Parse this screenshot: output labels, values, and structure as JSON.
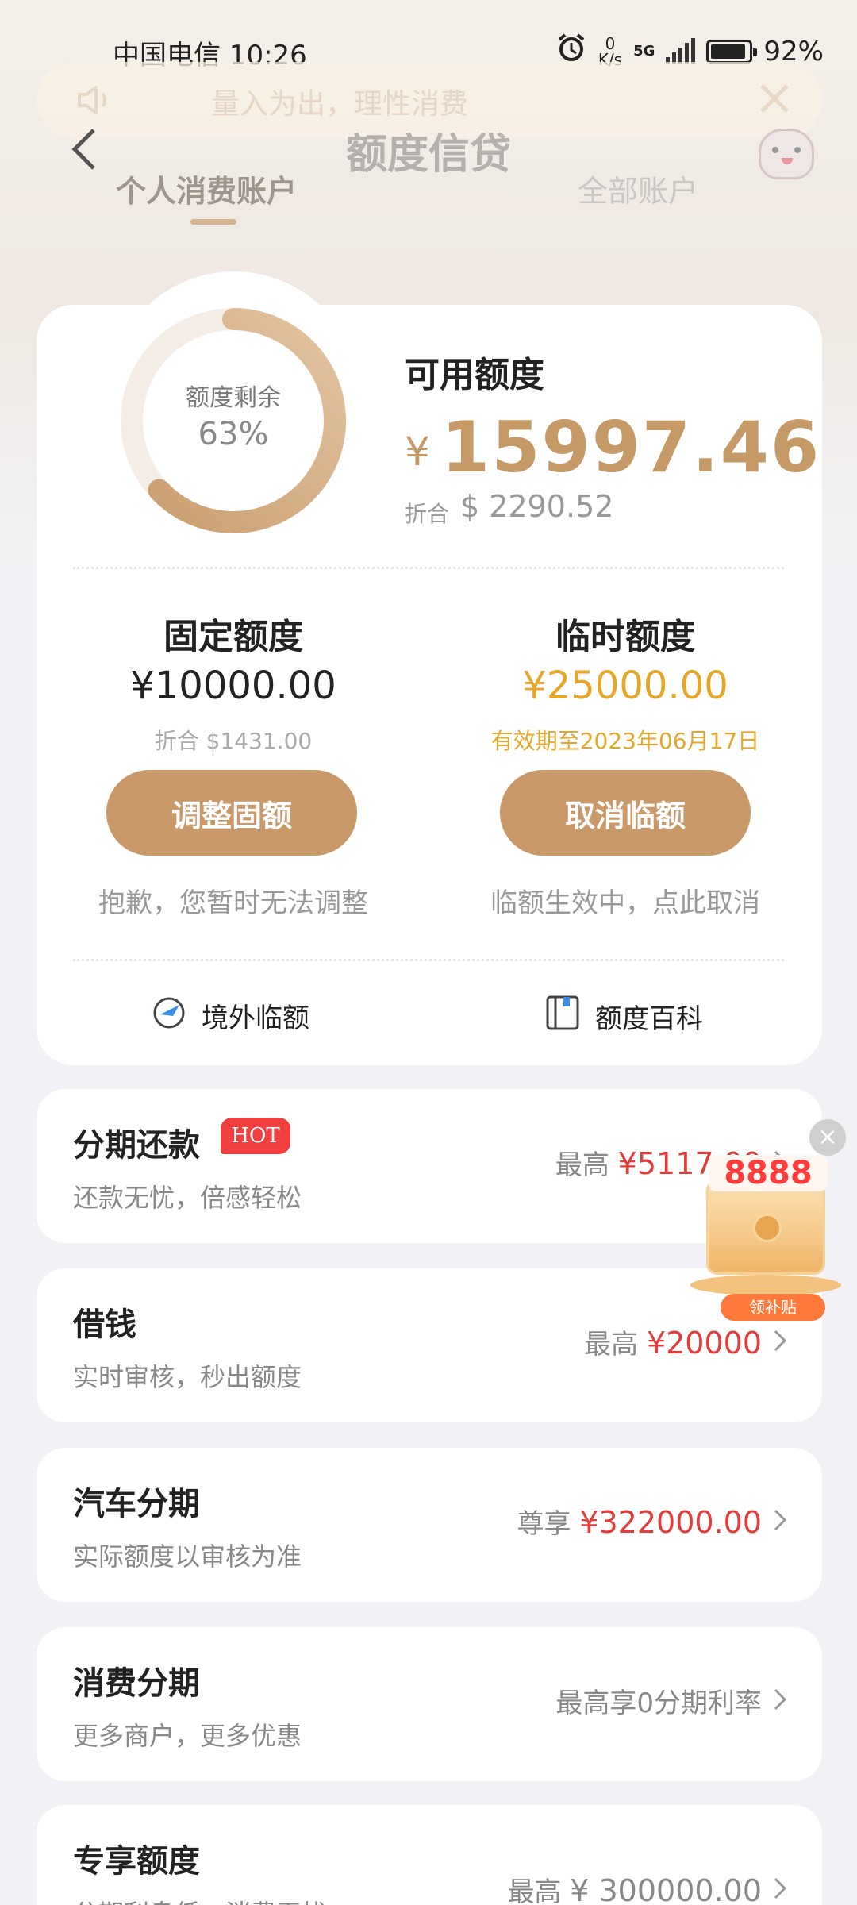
{
  "status_bar": {
    "carrier_time": "中国电信 10:26",
    "net_speed_value": "0",
    "net_speed_unit": "K/s",
    "network": "5G",
    "battery": "92%"
  },
  "notice": {
    "text": "量入为出，理性消费"
  },
  "header": {
    "title": "额度信贷"
  },
  "tabs": [
    {
      "label": "个人消费账户",
      "active": true
    },
    {
      "label": "全部账户",
      "active": false
    }
  ],
  "credit": {
    "remaining_label": "额度剩余",
    "remaining_percent_text": "63%",
    "remaining_fraction": 0.63,
    "available_label": "可用额度",
    "currency_symbol": "¥",
    "available_amount": "15997.46",
    "fx_label": "折合",
    "fx_value": "$ 2290.52"
  },
  "fixed": {
    "title": "固定额度",
    "amount": "¥10000.00",
    "sub": "折合 $1431.00",
    "button": "调整固额",
    "note": "抱歉，您暂时无法调整"
  },
  "temp": {
    "title": "临时额度",
    "amount": "¥25000.00",
    "sub": "有效期至2023年06月17日",
    "button": "取消临额",
    "note": "临额生效中，点此取消"
  },
  "links": {
    "overseas": "境外临额",
    "wiki": "额度百科"
  },
  "products": [
    {
      "title": "分期还款",
      "badge": "HOT",
      "sub": "还款无忧，倍感轻松",
      "prefix": "最高",
      "amount": "¥5117.00"
    },
    {
      "title": "借钱",
      "sub": "实时审核，秒出额度",
      "prefix": "最高",
      "amount": "¥20000"
    },
    {
      "title": "汽车分期",
      "sub": "实际额度以审核为准",
      "prefix": "尊享",
      "amount": "¥322000.00"
    },
    {
      "title": "消费分期",
      "sub": "更多商户，更多优惠",
      "prefix": "最高享0分期利率",
      "amount": ""
    },
    {
      "title": "专享额度",
      "sub": "分期利息低，消费无忧",
      "prefix": "最高",
      "amount": "¥ 300000.00"
    }
  ],
  "promo": {
    "number": "8888",
    "label": "领补贴"
  },
  "colors": {
    "accent_gold": "#c9996a",
    "temp_amount": "#e5a72a",
    "price_red": "#e23c3c",
    "hot_badge": "#ef3f3f"
  }
}
